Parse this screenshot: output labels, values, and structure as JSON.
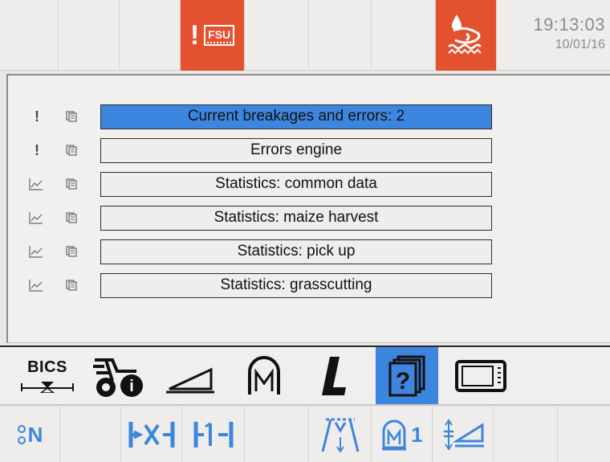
{
  "status_bar": {
    "fsu_alarm": {
      "label": "FSU",
      "icon": "fsu-alarm-icon",
      "color": "#e4512f"
    },
    "hydraulic_alarm": {
      "icon": "hydraulic-warning-icon",
      "color": "#e4512f"
    },
    "time": "19:13:03",
    "date": "10/01/16"
  },
  "menu": {
    "items": [
      {
        "label": "Current breakages and errors:  2",
        "status_icon": "!",
        "selected": true
      },
      {
        "label": "Errors engine",
        "status_icon": "!",
        "selected": false
      },
      {
        "label": "Statistics: common data",
        "status_icon": "chart",
        "selected": false
      },
      {
        "label": "Statistics: maize harvest",
        "status_icon": "chart",
        "selected": false
      },
      {
        "label": "Statistics: pick up",
        "status_icon": "chart",
        "selected": false
      },
      {
        "label": "Statistics: grasscutting",
        "status_icon": "chart",
        "selected": false
      }
    ],
    "selected_color": "#3d86df"
  },
  "toolbar": {
    "bics_label": "BICS",
    "items": [
      "bics-icon",
      "tractor-info-icon",
      "ramp-icon",
      "m-attachment-icon",
      "l-icon",
      "help-book-icon",
      "screen-icon"
    ],
    "active": "help-book-icon"
  },
  "bottom_bar": {
    "neutral_label": "N",
    "attachment_label": "1",
    "items": [
      "neutral-gear-icon",
      "fxh-icon",
      "fh-icon",
      "pickup-icon",
      "m-attachment-1-icon",
      "header-height-icon"
    ]
  }
}
